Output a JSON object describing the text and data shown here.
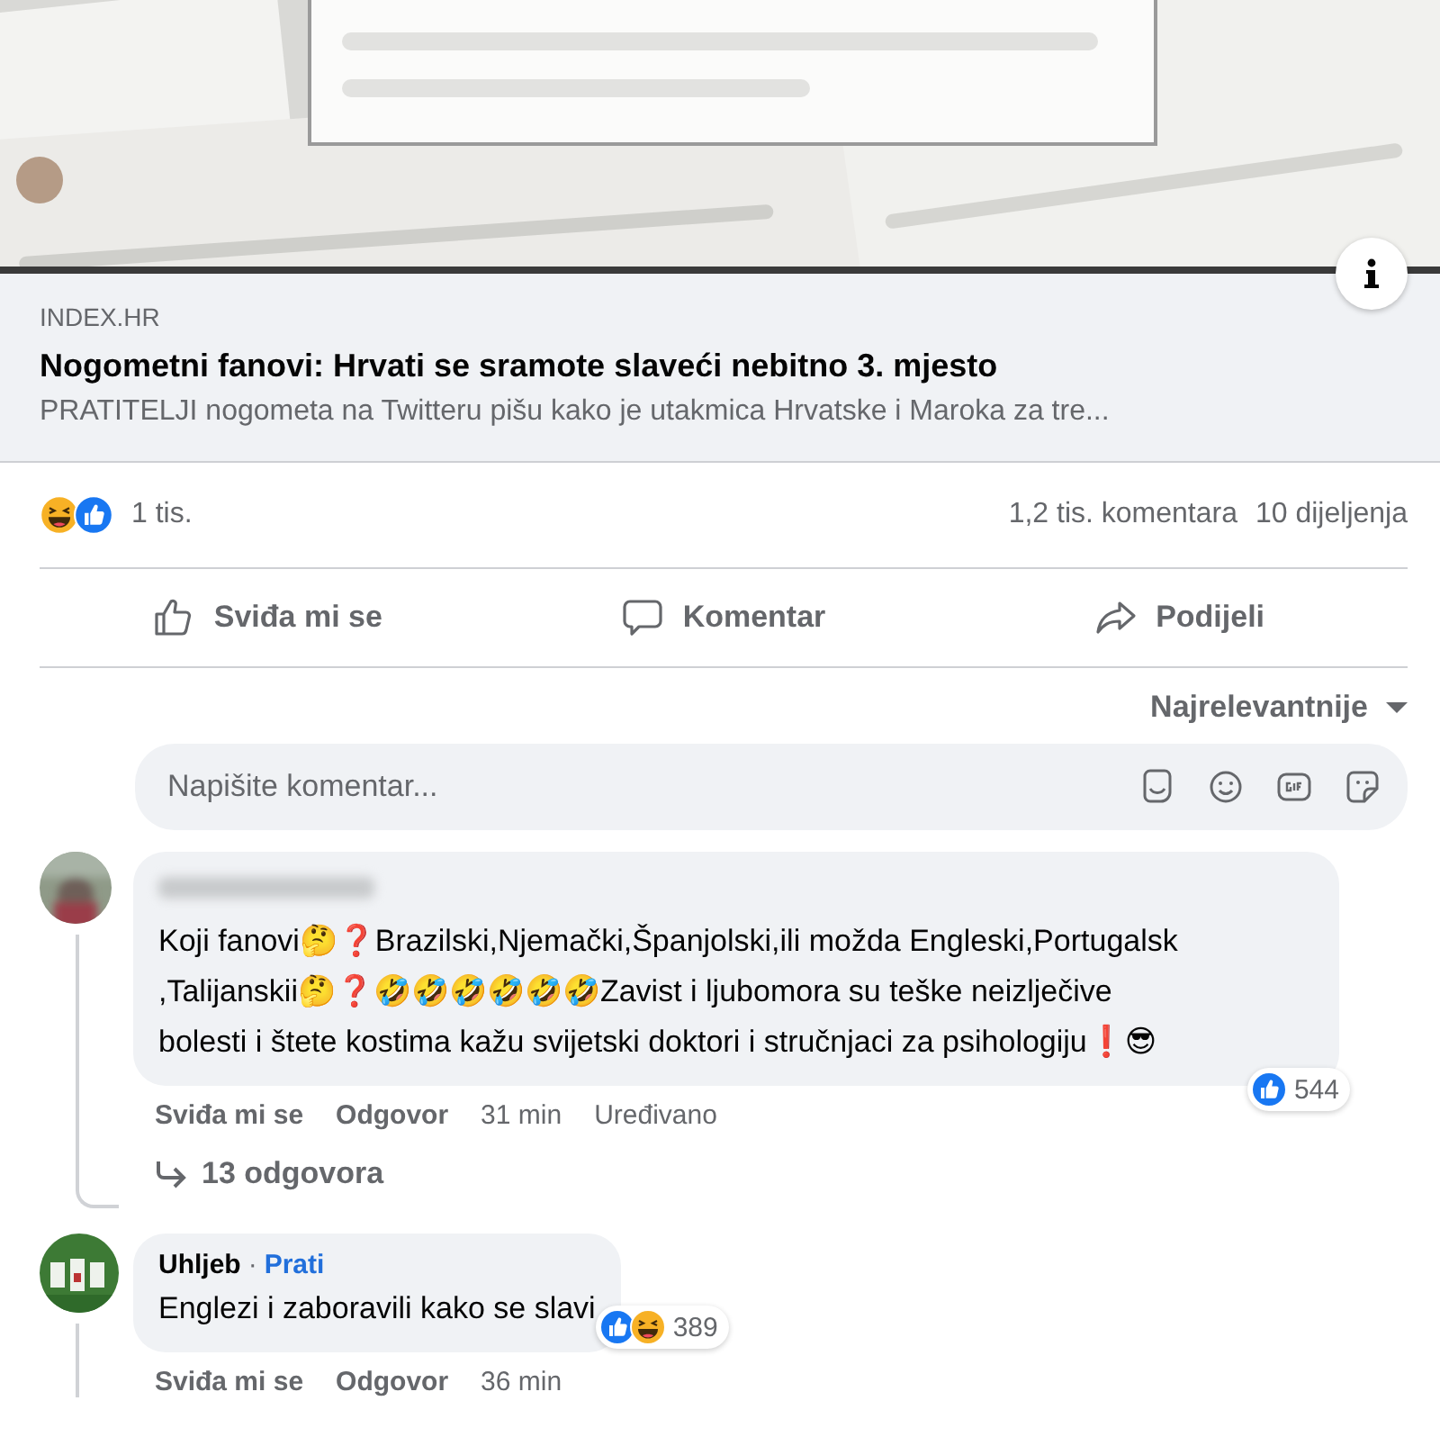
{
  "link_preview": {
    "source": "INDEX.HR",
    "title": "Nogometni fanovi: Hrvati se sramote slaveći nebitno 3. mjesto",
    "description": "PRATITELJI nogometa na Twitteru pišu kako je utakmica Hrvatske i Maroka za tre..."
  },
  "stats": {
    "reaction_kinds": [
      {
        "kind": "haha"
      },
      {
        "kind": "like"
      }
    ],
    "reactions": "1 tis.",
    "comments": "1,2 tis. komentara",
    "shares": "10 dijeljenja"
  },
  "actions": [
    {
      "kind": "like",
      "label": "Sviđa mi se"
    },
    {
      "kind": "comment",
      "label": "Komentar"
    },
    {
      "kind": "share",
      "label": "Podijeli"
    }
  ],
  "sort": {
    "label": "Najrelevantnije"
  },
  "comment_box": {
    "placeholder": "Napišite komentar..."
  },
  "comments": [
    {
      "text": "Koji fanovi🤔❓Brazilski,Njemački,Španjolski,ili možda Engleski,Portugalsk ,Talijanskii🤔❓🤣🤣🤣🤣🤣🤣Zavist i ljubomora su teške neizlječive bolesti i štete kostima kažu svijetski doktori i stručnjaci za psihologiju❗😎",
      "reaction_kinds": [
        {
          "kind": "like"
        }
      ],
      "reaction_count": "544",
      "like": "Sviđa mi se",
      "reply": "Odgovor",
      "time": "31 min",
      "edited": "Uređivano",
      "replies": "13 odgovora"
    },
    {
      "author": "Uhljeb",
      "separator": "·",
      "follow": "Prati",
      "text": "Englezi i zaboravili kako se slavi",
      "reaction_kinds": [
        {
          "kind": "like"
        },
        {
          "kind": "haha"
        }
      ],
      "reaction_count": "389",
      "like": "Sviđa mi se",
      "reply": "Odgovor",
      "time": "36 min"
    }
  ]
}
